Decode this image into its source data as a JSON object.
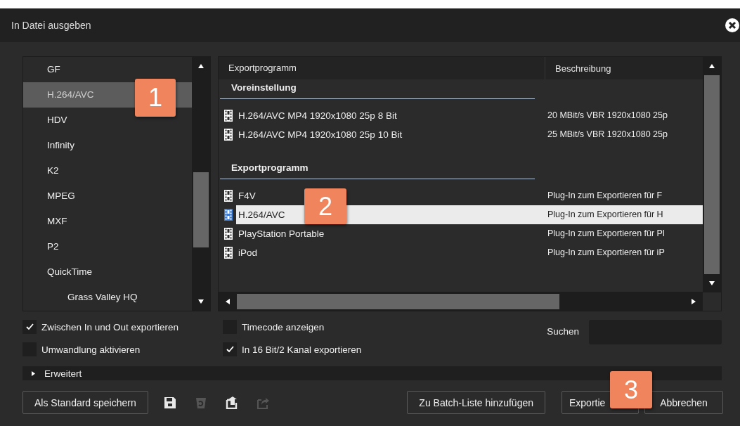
{
  "window": {
    "title": "In Datei ausgeben"
  },
  "format_list": {
    "items": [
      {
        "label": "GF",
        "selected": false
      },
      {
        "label": "H.264/AVC",
        "selected": true
      },
      {
        "label": "HDV",
        "selected": false
      },
      {
        "label": "Infinity",
        "selected": false
      },
      {
        "label": "K2",
        "selected": false
      },
      {
        "label": "MPEG",
        "selected": false
      },
      {
        "label": "MXF",
        "selected": false
      },
      {
        "label": "P2",
        "selected": false
      },
      {
        "label": "QuickTime",
        "selected": false,
        "children": [
          {
            "label": "Grass Valley HQ",
            "selected": false
          }
        ]
      }
    ]
  },
  "table": {
    "columns": [
      "Exportprogramm",
      "Beschreibung"
    ],
    "groups": [
      {
        "title": "Voreinstellung",
        "rows": [
          {
            "name": "H.264/AVC MP4 1920x1080 25p 8 Bit",
            "description": "20 MBit/s VBR 1920x1080 25p",
            "selected": false
          },
          {
            "name": "H.264/AVC MP4 1920x1080 25p 10 Bit",
            "description": "25 MBit/s VBR 1920x1080 25p",
            "selected": false
          }
        ]
      },
      {
        "title": "Exportprogramm",
        "rows": [
          {
            "name": "F4V",
            "description": "Plug-In zum Exportieren für F",
            "selected": false
          },
          {
            "name": "H.264/AVC",
            "description": "Plug-In zum Exportieren für H",
            "selected": true
          },
          {
            "name": "PlayStation Portable",
            "description": "Plug-In zum Exportieren für Pl",
            "selected": false
          },
          {
            "name": "iPod",
            "description": "Plug-In zum Exportieren für iP",
            "selected": false
          }
        ]
      }
    ]
  },
  "options": [
    {
      "label": "Zwischen In und Out exportieren",
      "checked": true
    },
    {
      "label": "Timecode anzeigen",
      "checked": false
    },
    {
      "label": "Umwandlung aktivieren",
      "checked": false
    },
    {
      "label": "In 16 Bit/2 Kanal exportieren",
      "checked": true
    }
  ],
  "search": {
    "label": "Suchen"
  },
  "advanced": {
    "label": "Erweitert",
    "expanded": false
  },
  "left_button": "Als Standard speichern",
  "icon_buttons": [
    {
      "kind": "save",
      "disabled": false
    },
    {
      "kind": "delete",
      "disabled": true
    },
    {
      "kind": "import",
      "disabled": false
    },
    {
      "kind": "export",
      "disabled": true
    }
  ],
  "right_buttons": [
    "Zu Batch-Liste hinzufügen",
    "Exportie",
    "Abbrechen"
  ],
  "callouts": [
    "1",
    "2",
    "3"
  ]
}
